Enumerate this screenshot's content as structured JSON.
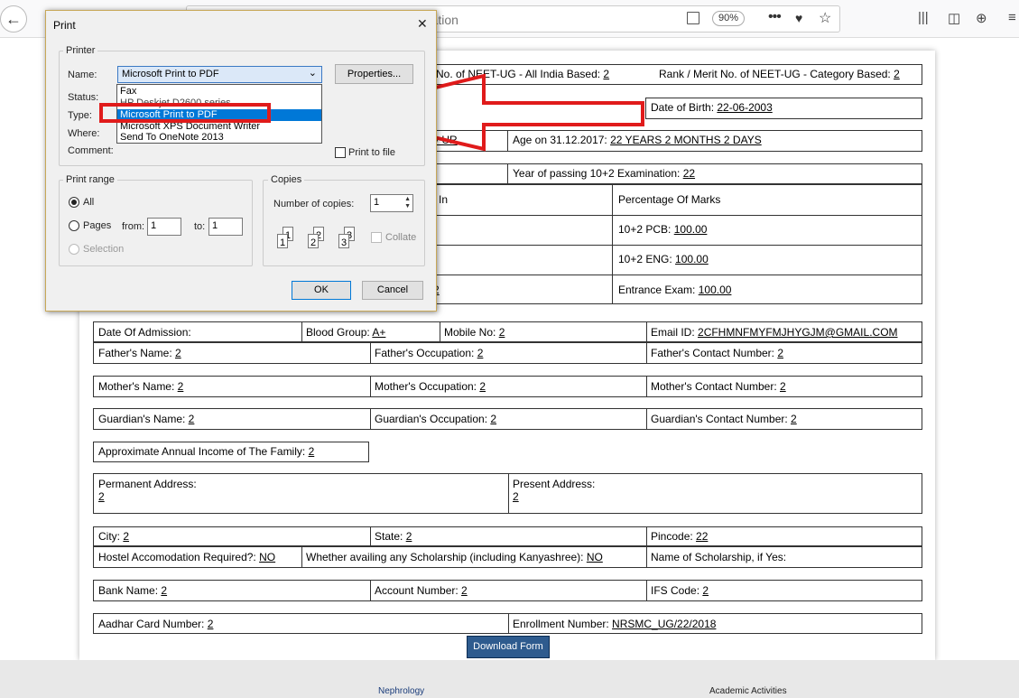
{
  "browser": {
    "url_fragment": "tration",
    "zoom": "90%",
    "more": "•••"
  },
  "form": {
    "rows": [
      {
        "neet_all_india": "No. of NEET-UG - All India Based: ",
        "neet_all_india_val": "2",
        "rank_cat": "Rank / Merit No. of NEET-UG - Category Based: ",
        "rank_cat_val": "2"
      },
      {
        "dob": "Date of Birth: ",
        "dob_val": "22-06-2003"
      },
      {
        "cat_val": "y UR",
        "age": "Age on 31.12.2017: ",
        "age_val": "22 YEARS 2 MONTHS 2 DAYS"
      },
      {
        "yop": "Year of passing 10+2 Examination: ",
        "yop_val": "22"
      },
      {
        "in": "In",
        "pom": "Percentage Of Marks"
      },
      {
        "pcb": "10+2 PCB: ",
        "pcb_val": "100.00"
      },
      {
        "eng": "10+2 ENG: ",
        "eng_val": "100.00"
      },
      {
        "ee_left": "2",
        "ee": "Entrance Exam: ",
        "ee_val": "100.00"
      }
    ],
    "admission": "Date Of Admission:",
    "blood": "Blood Group: ",
    "blood_val": "A+",
    "mobile": "Mobile No: ",
    "mobile_val": "2",
    "email": "Email ID: ",
    "email_val": "2CFHMNFMYFMJHYGJM@GMAIL.COM",
    "father_name": "Father's Name: ",
    "father_name_val": "2",
    "father_occ": "Father's Occupation: ",
    "father_occ_val": "2",
    "father_contact": "Father's Contact Number: ",
    "father_contact_val": "2",
    "mother_name": "Mother's Name: ",
    "mother_name_val": "2",
    "mother_occ": "Mother's Occupation: ",
    "mother_occ_val": "2",
    "mother_contact": "Mother's Contact Number: ",
    "mother_contact_val": "2",
    "guardian_name": "Guardian's Name: ",
    "guardian_name_val": "2",
    "guardian_occ": "Guardian's Occupation: ",
    "guardian_occ_val": "2",
    "guardian_contact": "Guardian's Contact Number: ",
    "guardian_contact_val": "2",
    "income": "Approximate Annual Income of The Family: ",
    "income_val": "2",
    "perm_addr": "Permanent Address:",
    "perm_addr_val": "2",
    "pres_addr": "Present Address:",
    "pres_addr_val": "2",
    "city": "City: ",
    "city_val": "2",
    "state": "State: ",
    "state_val": "2",
    "pincode": "Pincode: ",
    "pincode_val": "22",
    "hostel": "Hostel Accomodation Required?: ",
    "hostel_val": "NO",
    "scholarship": "Whether availing any Scholarship (including Kanyashree): ",
    "scholarship_val": "NO",
    "scholarship_name": "Name of Scholarship, if Yes:",
    "bank": "Bank Name: ",
    "bank_val": "2",
    "account": "Account Number: ",
    "account_val": "2",
    "ifs": "IFS Code: ",
    "ifs_val": "2",
    "aadhar": "Aadhar Card Number: ",
    "aadhar_val": "2",
    "enroll": "Enrollment Number: ",
    "enroll_val": "NRSMC_UG/22/2018",
    "download": "Download Form"
  },
  "footer": {
    "link1": "Nephrology",
    "link2": "Academic Activities"
  },
  "print_dialog": {
    "title": "Print",
    "printer_group": "Printer",
    "name_label": "Name:",
    "selected_printer": "Microsoft Print to PDF",
    "properties": "Properties...",
    "status_label": "Status:",
    "type_label": "Type:",
    "where_label": "Where:",
    "comment_label": "Comment:",
    "print_to_file": "Print to file",
    "printers": [
      "Fax",
      "HP Deskjet D2600 series",
      "Microsoft Print to PDF",
      "Microsoft XPS Document Writer",
      "Send To OneNote 2013"
    ],
    "range_group": "Print range",
    "all": "All",
    "pages": "Pages",
    "from": "from:",
    "from_val": "1",
    "to": "to:",
    "to_val": "1",
    "selection": "Selection",
    "copies_group": "Copies",
    "num_copies": "Number of copies:",
    "num_copies_val": "1",
    "collate": "Collate",
    "ok": "OK",
    "cancel": "Cancel"
  }
}
